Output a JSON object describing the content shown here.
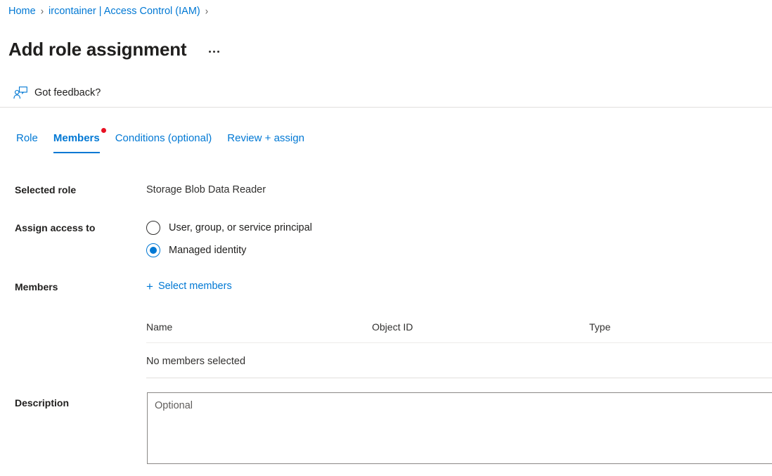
{
  "breadcrumb": {
    "items": [
      {
        "label": "Home",
        "icon": ""
      },
      {
        "label": "ircontainer | Access Control (IAM)",
        "icon": ""
      }
    ],
    "separator": "›"
  },
  "header": {
    "title": "Add role assignment",
    "more_menu_icon": "ellipsis-icon"
  },
  "feedback": {
    "label": "Got feedback?",
    "icon": "feedback-person-icon"
  },
  "tabs": [
    {
      "label": "Role",
      "active": false,
      "badge": false
    },
    {
      "label": "Members",
      "active": true,
      "badge": true
    },
    {
      "label": "Conditions (optional)",
      "active": false,
      "badge": false
    },
    {
      "label": "Review + assign",
      "active": false,
      "badge": false
    }
  ],
  "form": {
    "selected_role": {
      "label": "Selected role",
      "value": "Storage Blob Data Reader"
    },
    "assign_access_to": {
      "label": "Assign access to",
      "options": [
        {
          "label": "User, group, or service principal",
          "checked": false
        },
        {
          "label": "Managed identity",
          "checked": true
        }
      ]
    },
    "members": {
      "label": "Members",
      "select_members_label": "Select members",
      "plus_icon": "plus-icon",
      "table": {
        "columns": [
          "Name",
          "Object ID",
          "Type"
        ],
        "rows": [],
        "empty_text": "No members selected"
      }
    },
    "description": {
      "label": "Description",
      "value": "",
      "placeholder": "Optional"
    }
  },
  "colors": {
    "accent": "#0078d4",
    "badge_red": "#e81123",
    "text": "#201f1e",
    "divider": "#e1dfdd",
    "border": "#8a8886"
  }
}
